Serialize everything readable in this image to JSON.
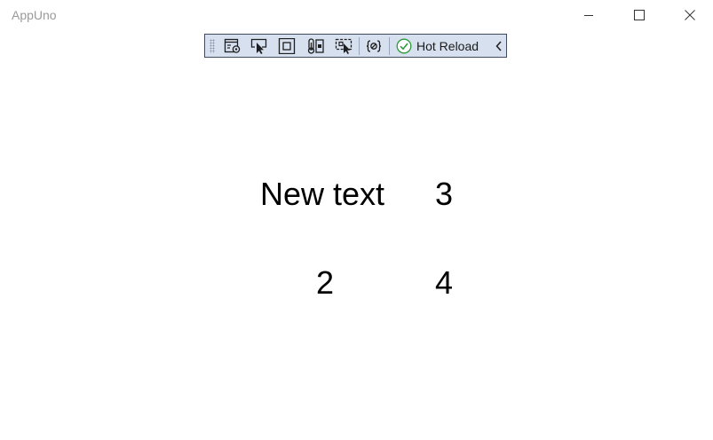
{
  "window": {
    "title": "AppUno",
    "controls": {
      "minimize_icon": "minimize-icon",
      "maximize_icon": "maximize-icon",
      "close_icon": "close-icon"
    }
  },
  "dev_toolbar": {
    "icons": [
      "live-visual-tree-icon",
      "select-element-icon",
      "display-layout-adorners-icon",
      "track-focused-element-icon",
      "preview-selection-icon",
      "binding-failures-icon"
    ],
    "hot_reload": {
      "label": "Hot Reload",
      "status": "ok",
      "status_color": "#2e9a3a"
    },
    "accent_background": "#d7e0ef",
    "border_color": "#3f4a5e"
  },
  "content": {
    "row1_col1": "New text",
    "row1_col2": "3",
    "row2_col1": "2",
    "row2_col2": "4"
  }
}
